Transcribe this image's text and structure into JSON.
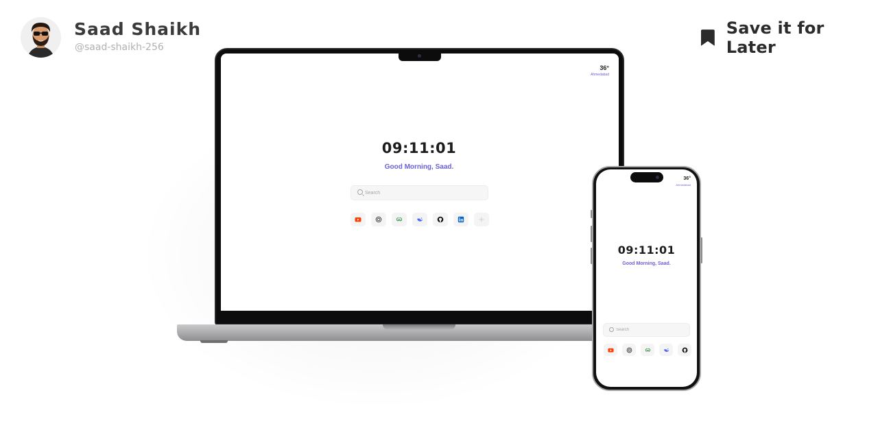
{
  "author": {
    "name": "Saad Shaikh",
    "handle": "@saad-shaikh-256"
  },
  "save_action": {
    "label": "Save it for Later",
    "icon": "bookmark-icon"
  },
  "newtab": {
    "weather": {
      "temperature": "36°",
      "city": "Ahmedabad"
    },
    "clock": "09:11:01",
    "greeting": "Good Morning, Saad.",
    "search_placeholder": "Search",
    "shortcuts_desktop": [
      {
        "name": "youtube-icon",
        "color": "#ff3d00"
      },
      {
        "name": "chatgpt-icon",
        "color": "#333333"
      },
      {
        "name": "geeksforgeeks-icon",
        "color": "#2f8d46"
      },
      {
        "name": "deepseek-icon",
        "color": "#4d6bfe"
      },
      {
        "name": "github-icon",
        "color": "#111111"
      },
      {
        "name": "linkedin-icon",
        "color": "#0a66c2"
      },
      {
        "name": "add-shortcut-icon",
        "color": "#c8c8c8"
      }
    ],
    "shortcuts_mobile": [
      {
        "name": "youtube-icon",
        "color": "#ff3d00"
      },
      {
        "name": "chatgpt-icon",
        "color": "#333333"
      },
      {
        "name": "geeksforgeeks-icon",
        "color": "#2f8d46"
      },
      {
        "name": "deepseek-icon",
        "color": "#4d6bfe"
      },
      {
        "name": "github-icon",
        "color": "#111111"
      }
    ]
  },
  "colors": {
    "accent": "#6b5fd6",
    "text_dark": "#1c1c1c",
    "handle_gray": "#b0b0b0"
  }
}
